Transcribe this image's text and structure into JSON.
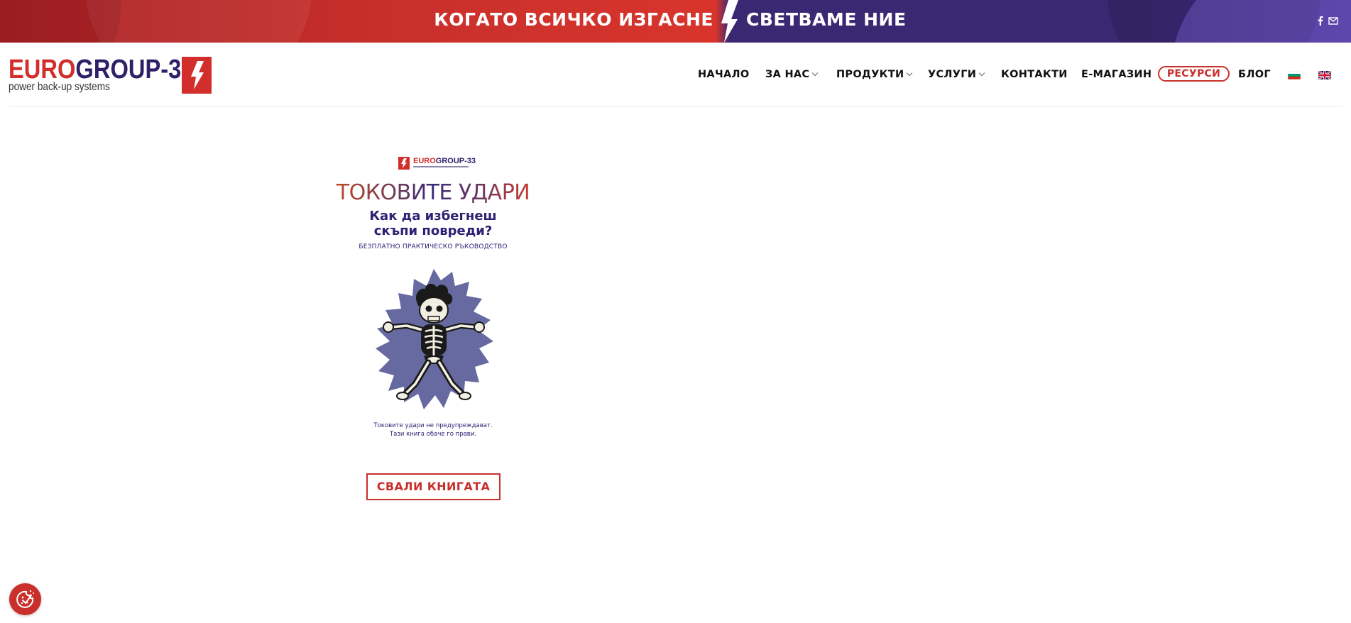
{
  "topbar": {
    "slogan_left": "КОГАТО ВСИЧКО ИЗГАСНЕ",
    "slogan_right": "СВЕТВАМЕ НИЕ",
    "social_icons": [
      "facebook-icon",
      "email-icon"
    ],
    "colors": {
      "red": "#d8342c",
      "purple": "#3b2873"
    }
  },
  "logo": {
    "word_red": "EURO",
    "word_blue": "GROUP-33",
    "tagline": "power back-up systems"
  },
  "nav": {
    "items": [
      {
        "label": "НАЧАЛО",
        "dropdown": false
      },
      {
        "label": "ЗА НАС",
        "dropdown": true
      },
      {
        "label": "ПРОДУКТИ",
        "dropdown": true
      },
      {
        "label": "УСЛУГИ",
        "dropdown": true
      },
      {
        "label": "КОНТАКТИ",
        "dropdown": false
      },
      {
        "label": "Е-МАГАЗИН",
        "dropdown": false
      },
      {
        "label": "РЕСУРСИ",
        "dropdown": false,
        "active": true
      },
      {
        "label": "БЛОГ",
        "dropdown": false
      }
    ],
    "languages": [
      "bulgarian-flag-icon",
      "uk-flag-icon"
    ],
    "active_color": "#c9302b"
  },
  "book": {
    "logo_red": "EURO",
    "logo_blue": "GROUP-33",
    "title": "ТОКОВИТЕ УДАРИ",
    "subtitle_line1": "Как да избегнеш",
    "subtitle_line2": "скъпи повреди?",
    "guide": "БЕЗПЛАТНО ПРАКТИЧЕСКО РЪКОВОДСТВО",
    "caption_line1": "Токовите удари не предупреждават.",
    "caption_line2": "Тази книга обаче го прави.",
    "illustration": "electrocuted-skeleton-illustration"
  },
  "cta": {
    "download_label": "СВАЛИ КНИГАТА"
  },
  "cookie": {
    "icon": "cookie-settings-icon",
    "color": "#c9302b"
  }
}
